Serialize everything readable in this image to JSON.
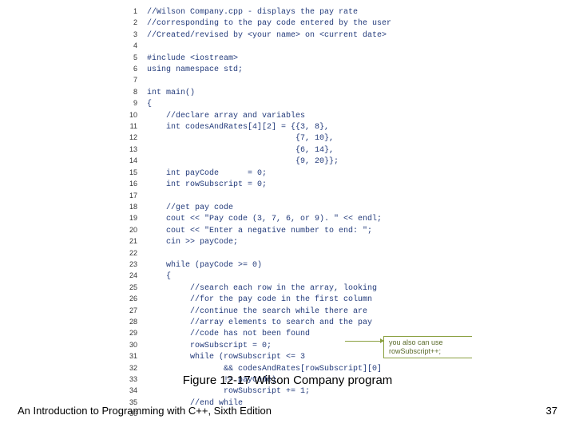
{
  "code": {
    "lines": [
      {
        "n": "1",
        "t": "//Wilson Company.cpp - displays the pay rate"
      },
      {
        "n": "2",
        "t": "//corresponding to the pay code entered by the user"
      },
      {
        "n": "3",
        "t": "//Created/revised by <your name> on <current date>"
      },
      {
        "n": "4",
        "t": ""
      },
      {
        "n": "5",
        "t": "#include <iostream>"
      },
      {
        "n": "6",
        "t": "using namespace std;"
      },
      {
        "n": "7",
        "t": ""
      },
      {
        "n": "8",
        "t": "int main()"
      },
      {
        "n": "9",
        "t": "{"
      },
      {
        "n": "10",
        "t": "    //declare array and variables"
      },
      {
        "n": "11",
        "t": "    int codesAndRates[4][2] = {{3, 8},"
      },
      {
        "n": "12",
        "t": "                               {7, 10},"
      },
      {
        "n": "13",
        "t": "                               {6, 14},"
      },
      {
        "n": "14",
        "t": "                               {9, 20}};"
      },
      {
        "n": "15",
        "t": "    int payCode      = 0;"
      },
      {
        "n": "16",
        "t": "    int rowSubscript = 0;"
      },
      {
        "n": "17",
        "t": ""
      },
      {
        "n": "18",
        "t": "    //get pay code"
      },
      {
        "n": "19",
        "t": "    cout << \"Pay code (3, 7, 6, or 9). \" << endl;"
      },
      {
        "n": "20",
        "t": "    cout << \"Enter a negative number to end: \";"
      },
      {
        "n": "21",
        "t": "    cin >> payCode;"
      },
      {
        "n": "22",
        "t": ""
      },
      {
        "n": "23",
        "t": "    while (payCode >= 0)"
      },
      {
        "n": "24",
        "t": "    {"
      },
      {
        "n": "25",
        "t": "         //search each row in the array, looking"
      },
      {
        "n": "26",
        "t": "         //for the pay code in the first column"
      },
      {
        "n": "27",
        "t": "         //continue the search while there are"
      },
      {
        "n": "28",
        "t": "         //array elements to search and the pay"
      },
      {
        "n": "29",
        "t": "         //code has not been found"
      },
      {
        "n": "30",
        "t": "         rowSubscript = 0;"
      },
      {
        "n": "31",
        "t": "         while (rowSubscript <= 3"
      },
      {
        "n": "32",
        "t": "                && codesAndRates[rowSubscript][0]"
      },
      {
        "n": "33",
        "t": "                != payCode)"
      },
      {
        "n": "34",
        "t": "                rowSubscript += 1;"
      },
      {
        "n": "35",
        "t": "         //end while"
      },
      {
        "n": "36",
        "t": ""
      }
    ]
  },
  "annotation": {
    "line1": "you also can use",
    "line2": "rowSubscript++;"
  },
  "caption": "Figure 12-17 Wilson Company program",
  "footer": {
    "left": "An Introduction to Programming with C++, Sixth Edition",
    "right": "37"
  }
}
